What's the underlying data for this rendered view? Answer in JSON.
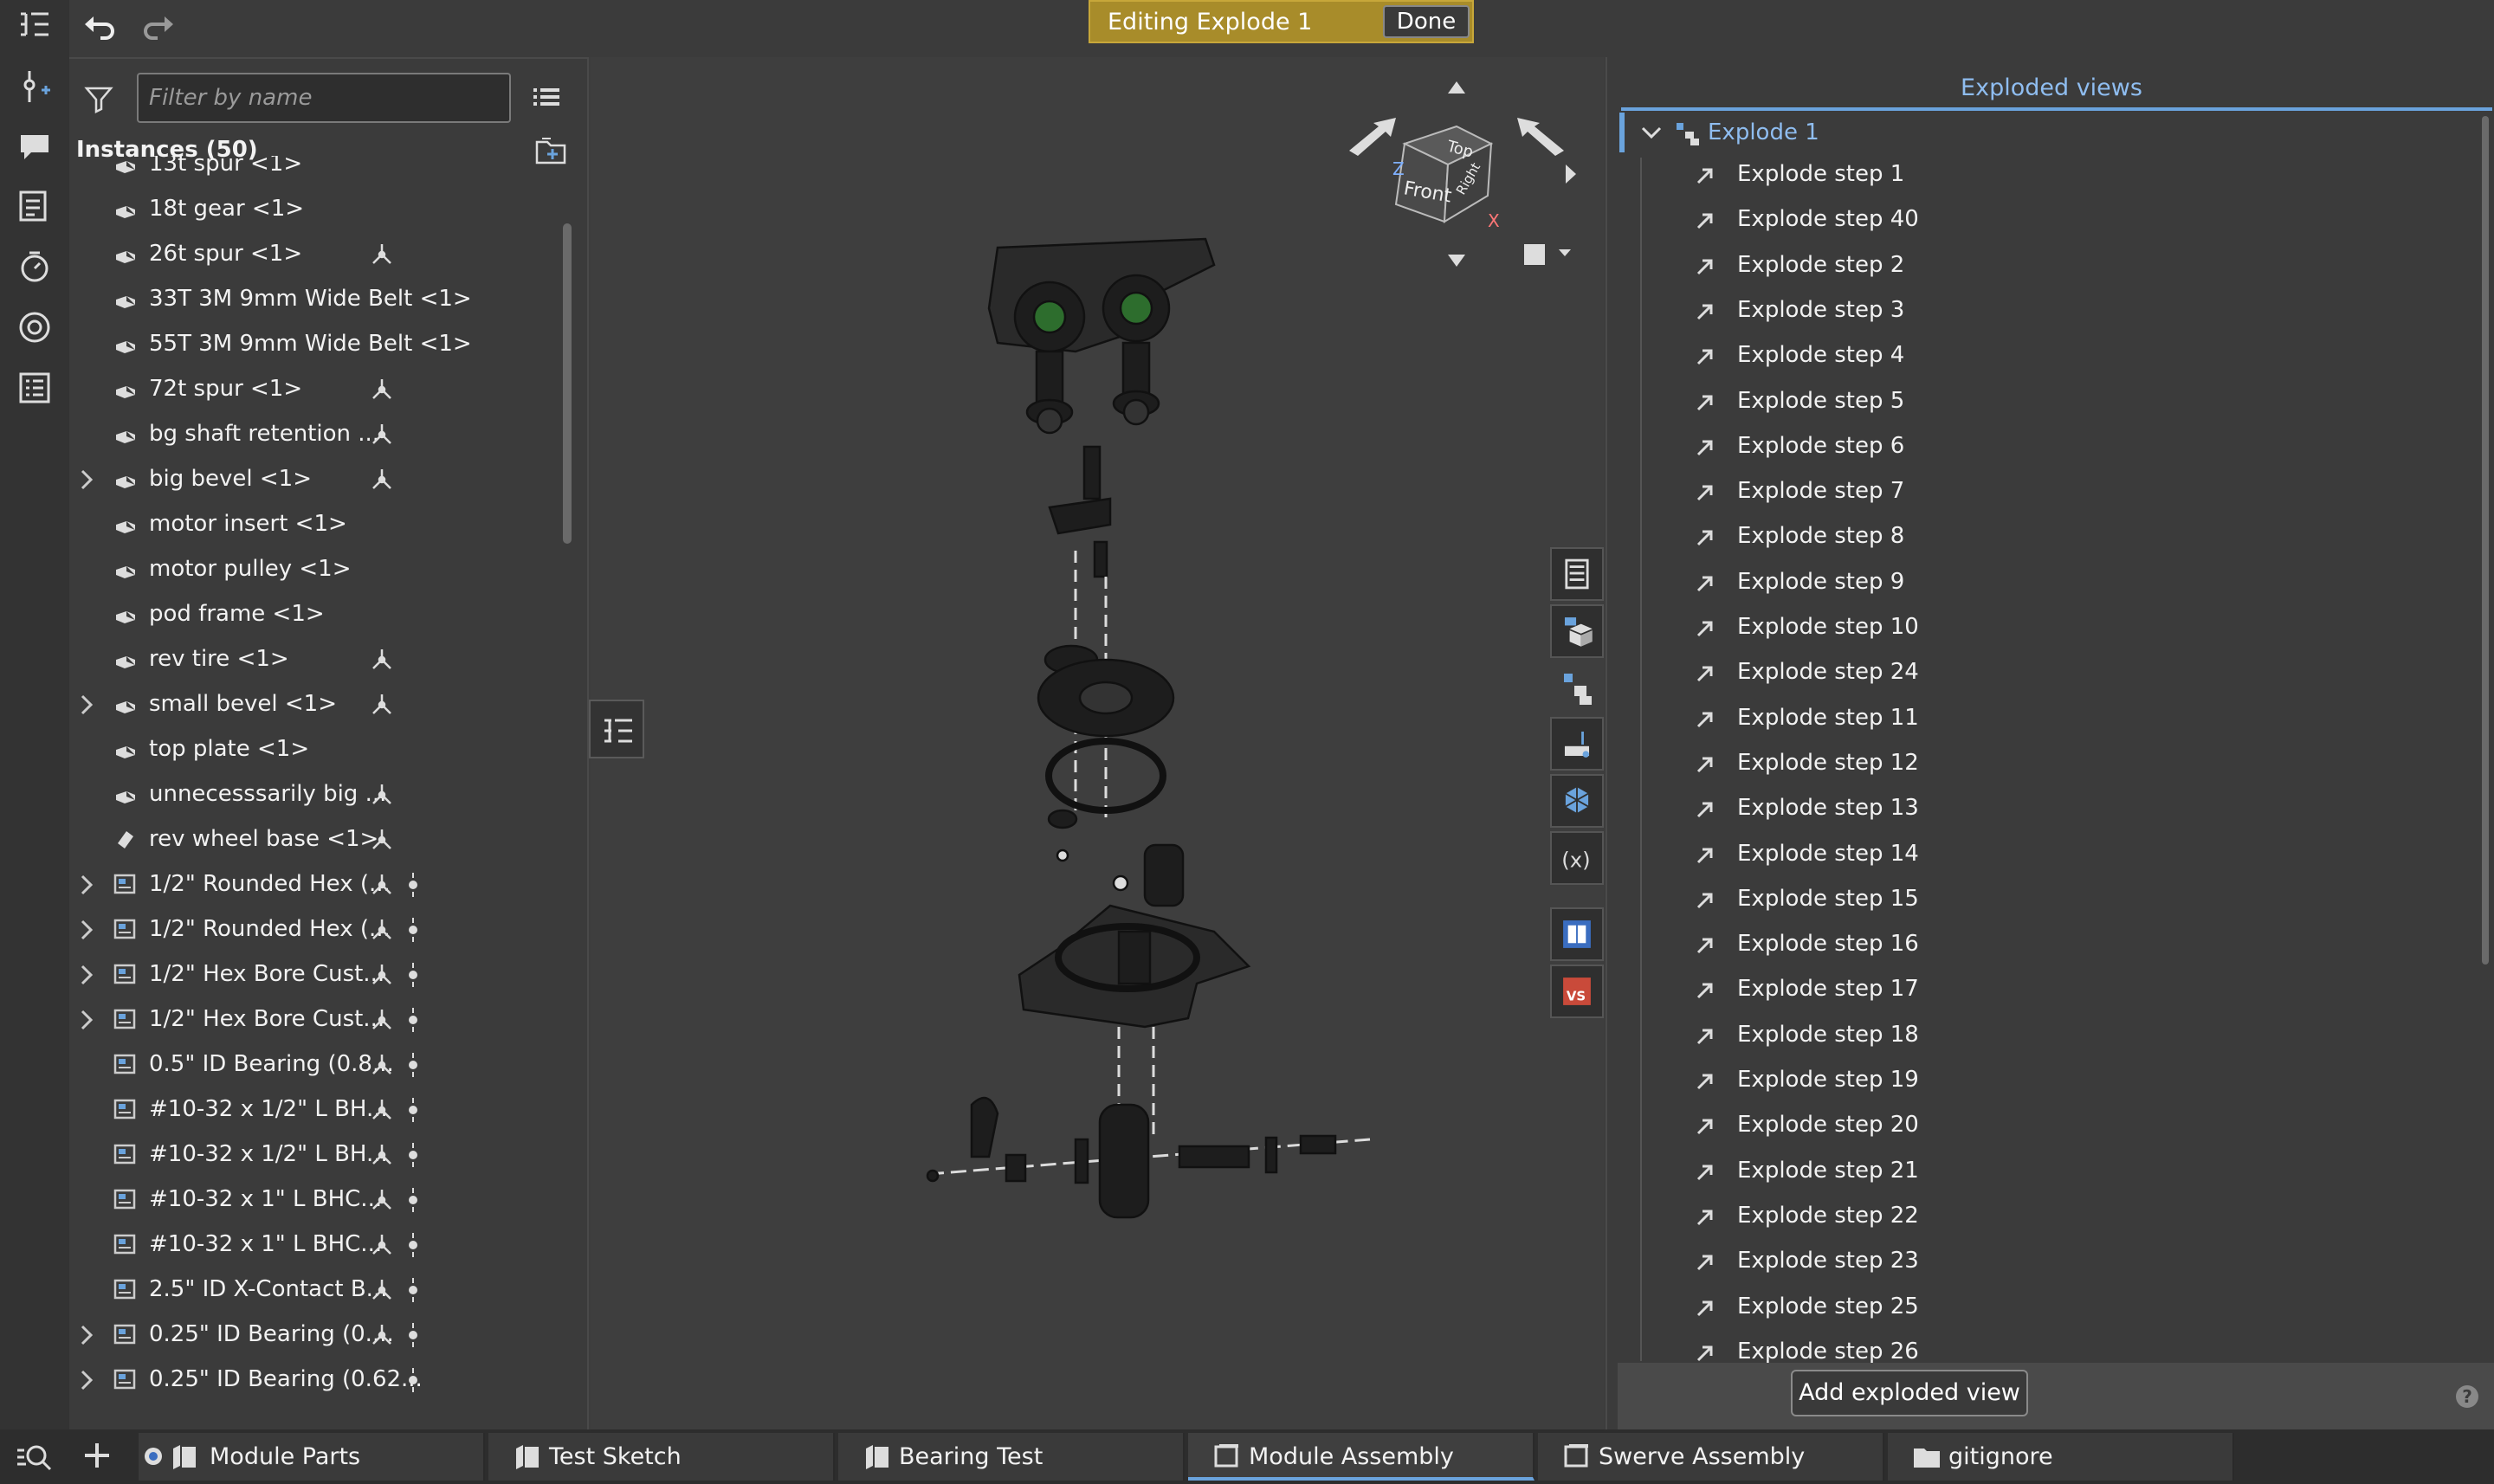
{
  "banner": {
    "text": "Editing Explode 1",
    "done_label": "Done"
  },
  "filter": {
    "placeholder": "Filter by name"
  },
  "instances": {
    "title": "Instances (50)",
    "rows": [
      {
        "label": "13t spur <1>",
        "expand": false,
        "mate": false,
        "dot": false,
        "icon": "part"
      },
      {
        "label": "18t gear <1>",
        "expand": false,
        "mate": false,
        "dot": false,
        "icon": "part"
      },
      {
        "label": "26t spur <1>",
        "expand": false,
        "mate": true,
        "dot": false,
        "icon": "part"
      },
      {
        "label": "33T 3M 9mm Wide Belt <1>",
        "expand": false,
        "mate": false,
        "dot": false,
        "icon": "part"
      },
      {
        "label": "55T 3M 9mm Wide Belt <1>",
        "expand": false,
        "mate": false,
        "dot": false,
        "icon": "part"
      },
      {
        "label": "72t spur <1>",
        "expand": false,
        "mate": true,
        "dot": false,
        "icon": "part"
      },
      {
        "label": "bg shaft retention ...",
        "expand": false,
        "mate": true,
        "dot": false,
        "icon": "part"
      },
      {
        "label": "big bevel <1>",
        "expand": true,
        "mate": true,
        "dot": false,
        "icon": "part"
      },
      {
        "label": "motor insert <1>",
        "expand": false,
        "mate": false,
        "dot": false,
        "icon": "part"
      },
      {
        "label": "motor pulley <1>",
        "expand": false,
        "mate": false,
        "dot": false,
        "icon": "part"
      },
      {
        "label": "pod frame <1>",
        "expand": false,
        "mate": false,
        "dot": false,
        "icon": "part"
      },
      {
        "label": "rev tire <1>",
        "expand": false,
        "mate": true,
        "dot": false,
        "icon": "part"
      },
      {
        "label": "small bevel <1>",
        "expand": true,
        "mate": true,
        "dot": false,
        "icon": "part"
      },
      {
        "label": "top plate <1>",
        "expand": false,
        "mate": false,
        "dot": false,
        "icon": "part"
      },
      {
        "label": "unnecesssarily big ...",
        "expand": false,
        "mate": true,
        "dot": false,
        "icon": "part"
      },
      {
        "label": "rev wheel base <1>",
        "expand": false,
        "mate": true,
        "dot": false,
        "icon": "part-fill"
      },
      {
        "label": "1/2\" Rounded Hex (...",
        "expand": true,
        "mate": true,
        "dot": true,
        "icon": "assembly"
      },
      {
        "label": "1/2\" Rounded Hex (...",
        "expand": true,
        "mate": true,
        "dot": true,
        "icon": "assembly"
      },
      {
        "label": "1/2\" Hex Bore Cust...",
        "expand": true,
        "mate": true,
        "dot": true,
        "icon": "assembly"
      },
      {
        "label": "1/2\" Hex Bore Cust...",
        "expand": true,
        "mate": true,
        "dot": true,
        "icon": "assembly"
      },
      {
        "label": "0.5\" ID Bearing (0.8...",
        "expand": false,
        "mate": true,
        "dot": true,
        "icon": "assembly"
      },
      {
        "label": "#10-32 x 1/2\" L BH...",
        "expand": false,
        "mate": true,
        "dot": true,
        "icon": "assembly"
      },
      {
        "label": "#10-32 x 1/2\" L BH...",
        "expand": false,
        "mate": true,
        "dot": true,
        "icon": "assembly"
      },
      {
        "label": "#10-32 x 1\" L BHC...",
        "expand": false,
        "mate": true,
        "dot": true,
        "icon": "assembly"
      },
      {
        "label": "#10-32 x 1\" L BHC...",
        "expand": false,
        "mate": true,
        "dot": true,
        "icon": "assembly"
      },
      {
        "label": "2.5\" ID X-Contact B...",
        "expand": false,
        "mate": true,
        "dot": true,
        "icon": "assembly"
      },
      {
        "label": "0.25\" ID Bearing (0....",
        "expand": true,
        "mate": true,
        "dot": true,
        "icon": "assembly"
      },
      {
        "label": "0.25\" ID Bearing (0.62...",
        "expand": true,
        "mate": false,
        "dot": true,
        "icon": "assembly"
      }
    ]
  },
  "viewcube": {
    "top": "Top",
    "front": "Front",
    "right": "Right",
    "z": "Z",
    "x": "X"
  },
  "exploded": {
    "title": "Exploded views",
    "root": "Explode 1",
    "steps": [
      "Explode step 1",
      "Explode step 40",
      "Explode step 2",
      "Explode step 3",
      "Explode step 4",
      "Explode step 5",
      "Explode step 6",
      "Explode step 7",
      "Explode step 8",
      "Explode step 9",
      "Explode step 10",
      "Explode step 24",
      "Explode step 11",
      "Explode step 12",
      "Explode step 13",
      "Explode step 14",
      "Explode step 15",
      "Explode step 16",
      "Explode step 17",
      "Explode step 18",
      "Explode step 19",
      "Explode step 20",
      "Explode step 21",
      "Explode step 22",
      "Explode step 23",
      "Explode step 25",
      "Explode step 26"
    ],
    "add_label": "Add exploded view",
    "help": "?"
  },
  "tabs": [
    {
      "label": "Module Parts",
      "active": false
    },
    {
      "label": "Test Sketch",
      "active": false
    },
    {
      "label": "Bearing Test",
      "active": false
    },
    {
      "label": "Module Assembly",
      "active": true
    },
    {
      "label": "Swerve Assembly",
      "active": false
    },
    {
      "label": "gitignore",
      "active": false
    }
  ],
  "colors": {
    "accent": "#6aa3dd",
    "banner": "#a88c2a"
  }
}
